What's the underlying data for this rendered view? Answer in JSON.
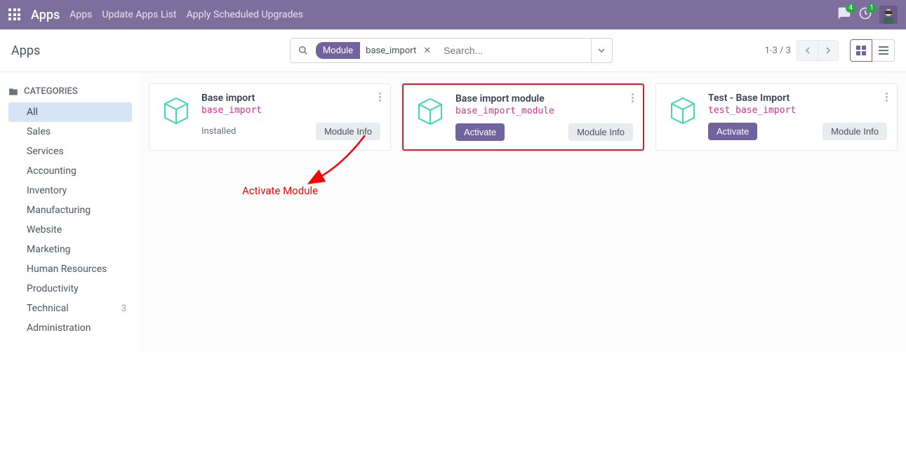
{
  "navbar": {
    "brand": "Apps",
    "links": [
      "Apps",
      "Update Apps List",
      "Apply Scheduled Upgrades"
    ],
    "msg_badge": "4",
    "activity_badge": "1"
  },
  "control": {
    "title": "Apps",
    "facet_label": "Module",
    "facet_value": "base_import",
    "search_placeholder": "Search...",
    "pager": "1-3 / 3"
  },
  "sidebar": {
    "header": "CATEGORIES",
    "items": [
      {
        "label": "All",
        "active": true
      },
      {
        "label": "Sales"
      },
      {
        "label": "Services"
      },
      {
        "label": "Accounting"
      },
      {
        "label": "Inventory"
      },
      {
        "label": "Manufacturing"
      },
      {
        "label": "Website"
      },
      {
        "label": "Marketing"
      },
      {
        "label": "Human Resources"
      },
      {
        "label": "Productivity"
      },
      {
        "label": "Technical",
        "count": "3"
      },
      {
        "label": "Administration"
      }
    ]
  },
  "cards": {
    "c0": {
      "title": "Base import",
      "tech": "base_import",
      "status": "Installed",
      "info": "Module Info"
    },
    "c1": {
      "title": "Base import module",
      "tech": "base_import_module",
      "activate": "Activate",
      "info": "Module Info"
    },
    "c2": {
      "title": "Test - Base Import",
      "tech": "test_base_import",
      "activate": "Activate",
      "info": "Module Info"
    }
  },
  "annotation": {
    "text": "Activate Module"
  }
}
